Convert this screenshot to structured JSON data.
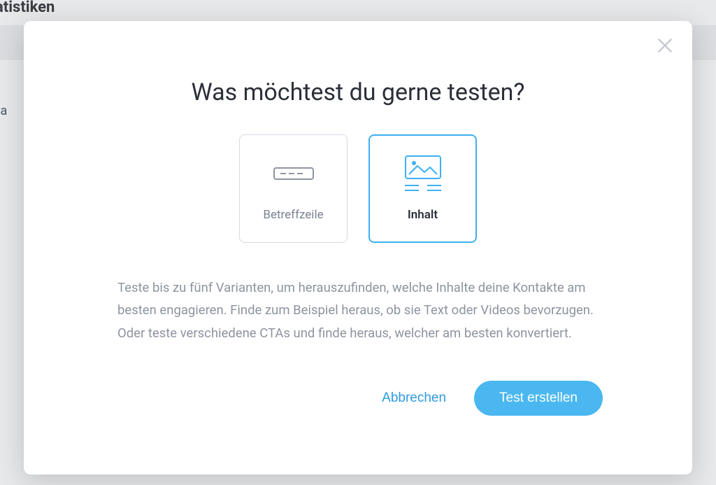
{
  "backdrop": {
    "pageTitle": "Statistiken",
    "sideText": "rla"
  },
  "modal": {
    "title": "Was möchtest du gerne testen?",
    "options": [
      {
        "label": "Betreffzeile"
      },
      {
        "label": "Inhalt"
      }
    ],
    "description": "Teste bis zu fünf Varianten, um herauszufinden, welche Inhalte deine Kontakte am besten engagieren. Finde zum Beispiel heraus, ob sie Text oder Videos bevorzugen. Oder teste verschiedene CTAs und finde heraus, welcher am besten konvertiert.",
    "actions": {
      "cancel": "Abbrechen",
      "create": "Test erstellen"
    },
    "selectedIndex": 1
  }
}
